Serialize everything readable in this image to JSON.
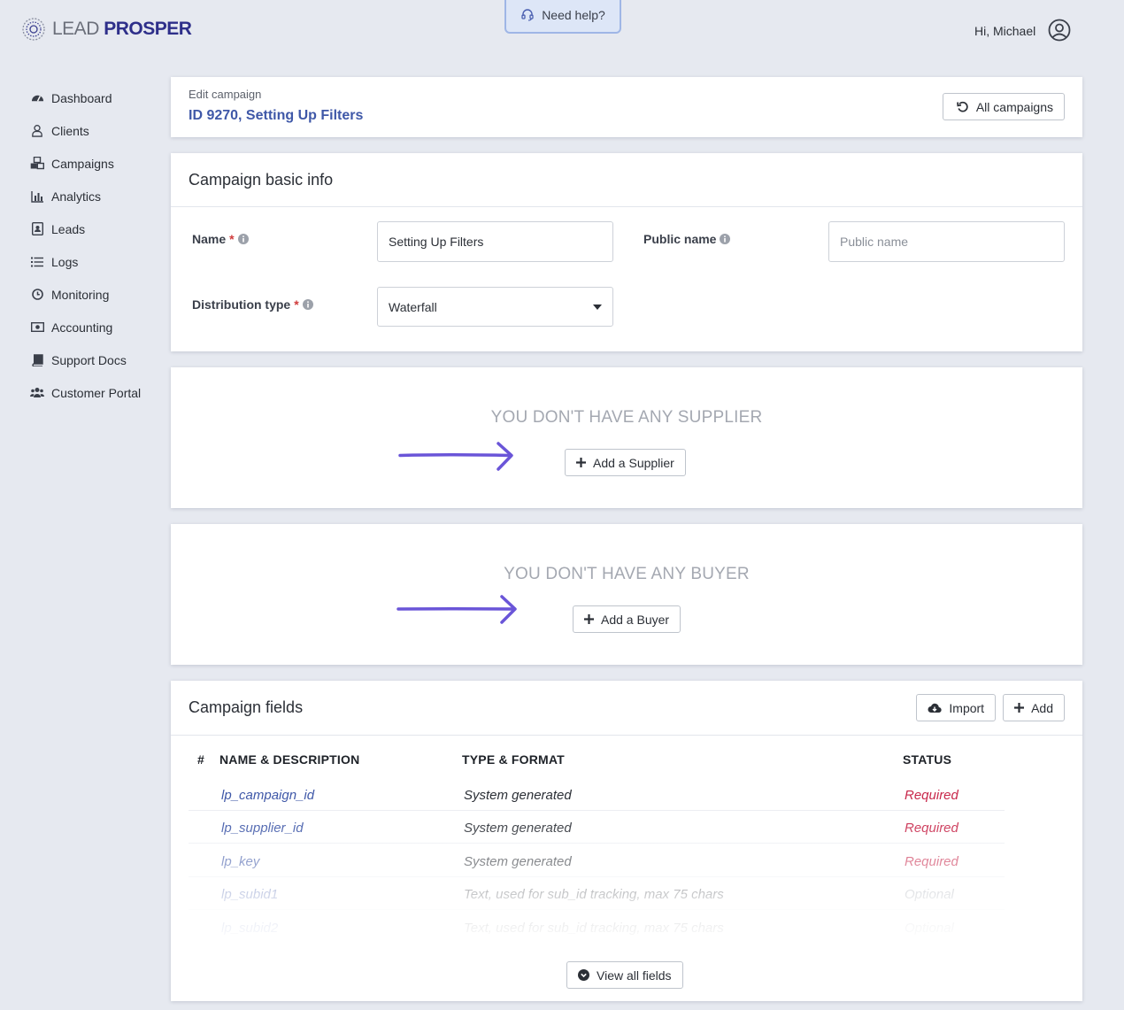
{
  "header": {
    "logo_light": "LEAD",
    "logo_bold": "PROSPER",
    "help_label": "Need help?",
    "greeting": "Hi, Michael"
  },
  "sidebar": {
    "items": [
      {
        "label": "Dashboard",
        "icon": "dashboard-icon"
      },
      {
        "label": "Clients",
        "icon": "user-icon"
      },
      {
        "label": "Campaigns",
        "icon": "cubes-icon"
      },
      {
        "label": "Analytics",
        "icon": "bar-chart-icon"
      },
      {
        "label": "Leads",
        "icon": "contact-card-icon"
      },
      {
        "label": "Logs",
        "icon": "list-icon"
      },
      {
        "label": "Monitoring",
        "icon": "clock-icon"
      },
      {
        "label": "Accounting",
        "icon": "money-icon"
      },
      {
        "label": "Support Docs",
        "icon": "book-icon"
      },
      {
        "label": "Customer Portal",
        "icon": "users-icon"
      }
    ]
  },
  "edit_card": {
    "subtitle": "Edit campaign",
    "title": "ID 9270, Setting Up Filters",
    "all_campaigns_label": "All campaigns"
  },
  "basic_info": {
    "title": "Campaign basic info",
    "name_label": "Name",
    "name_value": "Setting Up Filters",
    "public_name_label": "Public name",
    "public_name_placeholder": "Public name",
    "distribution_label": "Distribution type",
    "distribution_value": "Waterfall",
    "required_mark": "*"
  },
  "supplier": {
    "empty_text": "YOU DON'T HAVE ANY SUPPLIER",
    "add_label": "Add a Supplier"
  },
  "buyer": {
    "empty_text": "YOU DON'T HAVE ANY BUYER",
    "add_label": "Add a Buyer"
  },
  "fields": {
    "title": "Campaign fields",
    "import_label": "Import",
    "add_label": "Add",
    "columns": {
      "num": "#",
      "name": "NAME & DESCRIPTION",
      "type": "TYPE & FORMAT",
      "status": "STATUS"
    },
    "rows": [
      {
        "name": "lp_campaign_id",
        "type": "System generated",
        "status": "Required"
      },
      {
        "name": "lp_supplier_id",
        "type": "System generated",
        "status": "Required"
      },
      {
        "name": "lp_key",
        "type": "System generated",
        "status": "Required"
      },
      {
        "name": "lp_subid1",
        "type": "Text, used for sub_id tracking, max 75 chars",
        "status": "Optional"
      },
      {
        "name": "lp_subid2",
        "type": "Text, used for sub_id tracking, max 75 chars",
        "status": "Optional"
      }
    ],
    "view_all_label": "View all fields"
  },
  "colors": {
    "accent": "#3f58a8",
    "arrow": "#6a55d8",
    "required": "#c8284b",
    "background": "#e6e9f0"
  }
}
